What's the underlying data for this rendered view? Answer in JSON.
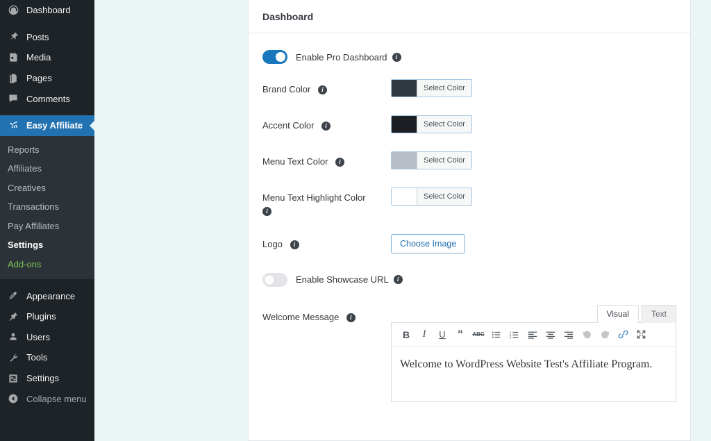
{
  "sidebar": {
    "items": [
      {
        "label": "Dashboard",
        "icon": "dashboard-icon",
        "name": "dashboard"
      },
      {
        "label": "Posts",
        "icon": "pin-icon",
        "name": "posts"
      },
      {
        "label": "Media",
        "icon": "media-icon",
        "name": "media"
      },
      {
        "label": "Pages",
        "icon": "pages-icon",
        "name": "pages"
      },
      {
        "label": "Comments",
        "icon": "comment-icon",
        "name": "comments"
      },
      {
        "label": "Easy Affiliate",
        "icon": "easy-affiliate-icon",
        "name": "easy-affiliate"
      },
      {
        "label": "Appearance",
        "icon": "appearance-icon",
        "name": "appearance"
      },
      {
        "label": "Plugins",
        "icon": "plugins-icon",
        "name": "plugins"
      },
      {
        "label": "Users",
        "icon": "users-icon",
        "name": "users"
      },
      {
        "label": "Tools",
        "icon": "tools-icon",
        "name": "tools"
      },
      {
        "label": "Settings",
        "icon": "settings-icon",
        "name": "settings"
      },
      {
        "label": "Collapse menu",
        "icon": "collapse-icon",
        "name": "collapse-menu"
      }
    ],
    "submenu": [
      {
        "label": "Reports"
      },
      {
        "label": "Affiliates"
      },
      {
        "label": "Creatives"
      },
      {
        "label": "Transactions"
      },
      {
        "label": "Pay Affiliates"
      },
      {
        "label": "Settings"
      },
      {
        "label": "Add-ons"
      }
    ],
    "active_item": "Easy Affiliate",
    "active_submenu": "Settings",
    "active_color": "#2271b1",
    "background": "#1d2327",
    "submenu_background": "#2c3338",
    "addons_color": "#7ec254"
  },
  "panel": {
    "title": "Dashboard",
    "pro_dashboard": {
      "label": "Enable Pro Dashboard",
      "state": "on"
    },
    "fields": [
      {
        "label": "Brand Color",
        "control": "color",
        "button_label": "Select Color",
        "value": "#2f3741"
      },
      {
        "label": "Accent Color",
        "control": "color",
        "button_label": "Select Color",
        "value": "#1b1f24"
      },
      {
        "label": "Menu Text Color",
        "control": "color",
        "button_label": "Select Color",
        "value": "#b9bfc6"
      },
      {
        "label": "Menu Text Highlight Color",
        "control": "color",
        "button_label": "Select Color",
        "value": "#ffffff"
      },
      {
        "label": "Logo",
        "control": "image",
        "button_label": "Choose Image"
      }
    ],
    "showcase_url": {
      "label": "Enable Showcase URL",
      "state": "off"
    },
    "welcome_message": {
      "label": "Welcome Message",
      "tabs": [
        {
          "label": "Visual",
          "active": true
        },
        {
          "label": "Text",
          "active": false
        }
      ],
      "toolbar": [
        {
          "name": "bold-icon",
          "title": "Bold"
        },
        {
          "name": "italic-icon",
          "title": "Italic"
        },
        {
          "name": "underline-icon",
          "title": "Underline"
        },
        {
          "name": "blockquote-icon",
          "title": "Blockquote"
        },
        {
          "name": "strikethrough-icon",
          "title": "Strikethrough"
        },
        {
          "name": "bulleted-list-icon",
          "title": "Bulleted list"
        },
        {
          "name": "numbered-list-icon",
          "title": "Numbered list"
        },
        {
          "name": "align-left-icon",
          "title": "Align left"
        },
        {
          "name": "align-center-icon",
          "title": "Align center"
        },
        {
          "name": "align-right-icon",
          "title": "Align right"
        },
        {
          "name": "undo-icon",
          "title": "Undo"
        },
        {
          "name": "redo-icon",
          "title": "Redo"
        },
        {
          "name": "link-icon",
          "title": "Insert link"
        },
        {
          "name": "fullscreen-icon",
          "title": "Fullscreen"
        }
      ],
      "content": "Welcome to WordPress Website Test's Affiliate Program."
    }
  }
}
